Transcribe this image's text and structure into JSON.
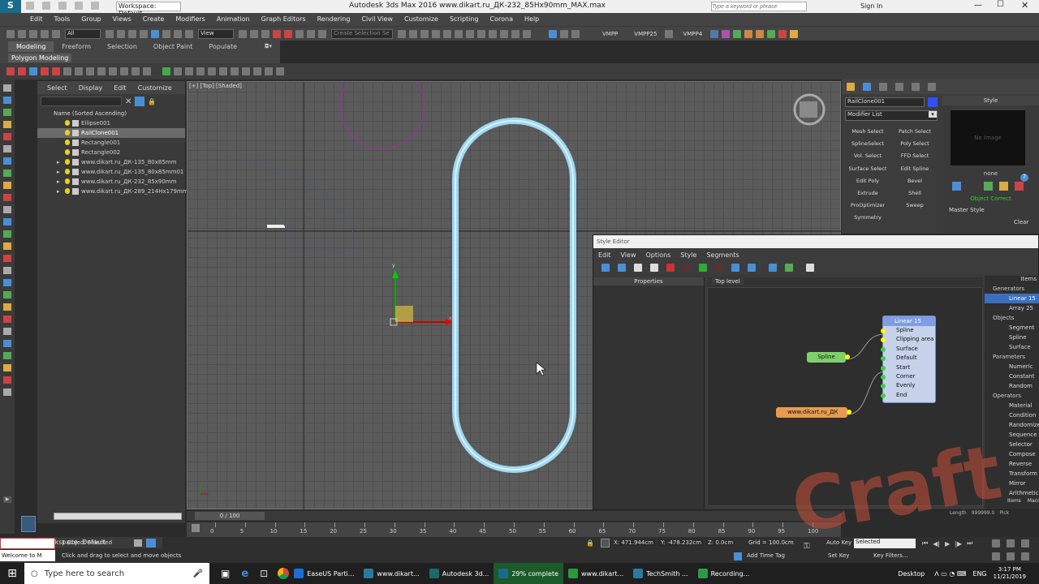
{
  "titlebar": {
    "workspace": "Workspace: Default",
    "title": "Autodesk 3ds Max 2016     www.dikart.ru_ДК-232_85Hx90mm_MAX.max",
    "search_placeholder": "Type a keyword or phrase",
    "signin": "Sign In"
  },
  "menu": [
    "Edit",
    "Tools",
    "Group",
    "Views",
    "Create",
    "Modifiers",
    "Animation",
    "Graph Editors",
    "Rendering",
    "Civil View",
    "Customize",
    "Scripting",
    "Corona",
    "Help"
  ],
  "toolbar": {
    "filter": "All",
    "view": "View",
    "selset_placeholder": "Create Selection Se",
    "vmpp": "VMPP",
    "vmpp25": "VMPP25",
    "vmpp4": "VMPP4"
  },
  "ribbon": {
    "tabs": [
      "Modeling",
      "Freeform",
      "Selection",
      "Object Paint",
      "Populate"
    ],
    "sub": "Polygon Modeling"
  },
  "scene": {
    "menu": [
      "Select",
      "Display",
      "Edit",
      "Customize"
    ],
    "header": "Name (Sorted Ascending)",
    "items": [
      "Ellipse001",
      "RailClone001",
      "Rectangle001",
      "Rectangle002",
      "www.dikart.ru_ДК-135_80x85mm",
      "www.dikart.ru_ДК-135_80x85mm01",
      "www.dikart.ru_ДК-232_85x90mm",
      "www.dikart.ru_ДК-289_214Hx179mm"
    ],
    "selected_index": 1
  },
  "viewport": {
    "label": "[+] [Top] [Shaded]"
  },
  "cmd": {
    "object_name": "RailClone001",
    "modifier_list": "Modifier List",
    "buttons": [
      "Mesh Select",
      "Patch Select",
      "SplineSelect",
      "Poly Select",
      "Vol. Select",
      "FFD Select",
      "Surface Select",
      "Edit Spline",
      "Edit Poly",
      "Bevel",
      "Extrude",
      "Shell",
      "ProOptimizer",
      "Sweep",
      "Symmetry"
    ],
    "style_header": "Style",
    "no_image": "No Image",
    "none": "none",
    "object_correct": "Object Correct",
    "master_style": "Master Style",
    "clear": "Clear"
  },
  "style_editor": {
    "title": "Style Editor",
    "menu": [
      "Edit",
      "View",
      "Options",
      "Style",
      "Segments"
    ],
    "properties": "Properties",
    "top_level": "Top level",
    "items_header": "Items",
    "categories": [
      {
        "name": "Generators",
        "items": [
          "Linear 15",
          "Array 25"
        ]
      },
      {
        "name": "Objects",
        "items": [
          "Segment",
          "Spline",
          "Surface"
        ]
      },
      {
        "name": "Parameters",
        "items": [
          "Numeric",
          "Constant",
          "Random"
        ]
      },
      {
        "name": "Operators",
        "items": [
          "Material",
          "Condition",
          "Randomize",
          "Sequence",
          "Selector",
          "Compose",
          "Reverse",
          "Transform",
          "Mirror",
          "Arithmetic"
        ]
      }
    ],
    "selected_item": "Linear 15",
    "tabs": [
      "Items",
      "Macros"
    ],
    "node_linear": {
      "title": "Linear 15",
      "ports": [
        "Spline",
        "Clipping area",
        "Surface",
        "Default",
        "Start",
        "Corner",
        "Evenly",
        "End"
      ]
    },
    "node_spline": "Spline",
    "node_segment": "www.dikart.ru_ДК",
    "length_label": "Length",
    "length_value": "999999.0",
    "pick": "Pick"
  },
  "timeline": {
    "frame": "0 / 100",
    "ticks": [
      "0",
      "5",
      "10",
      "15",
      "20",
      "25",
      "30",
      "35",
      "40",
      "45",
      "50",
      "55",
      "60",
      "65",
      "70",
      "75",
      "80",
      "85",
      "90",
      "95",
      "100"
    ]
  },
  "status": {
    "workspace": "Workspace: Default",
    "selected": "1 Object Selected",
    "hint": "Click and drag to select and move objects",
    "maxscript": "Welcome to M",
    "x": "X: 471.944cm",
    "y": "Y: -478.232cm",
    "z": "Z: 0.0cm",
    "grid": "Grid = 100.0cm",
    "add_time_tag": "Add Time Tag",
    "autokey": "Auto Key",
    "selected_dd": "Selected",
    "setkey": "Set Key",
    "keyfilters": "Key Filters..."
  },
  "taskbar": {
    "search": "Type here to search",
    "apps": [
      "EaseUS Parti...",
      "www.dikart...",
      "Autodesk 3d...",
      "29% complete",
      "www.dikart...",
      "TechSmith ...",
      "Recording..."
    ],
    "desktop": "Desktop",
    "lang": "ENG",
    "time": "3:17 PM",
    "date": "11/21/2019"
  },
  "watermark": "Craft"
}
